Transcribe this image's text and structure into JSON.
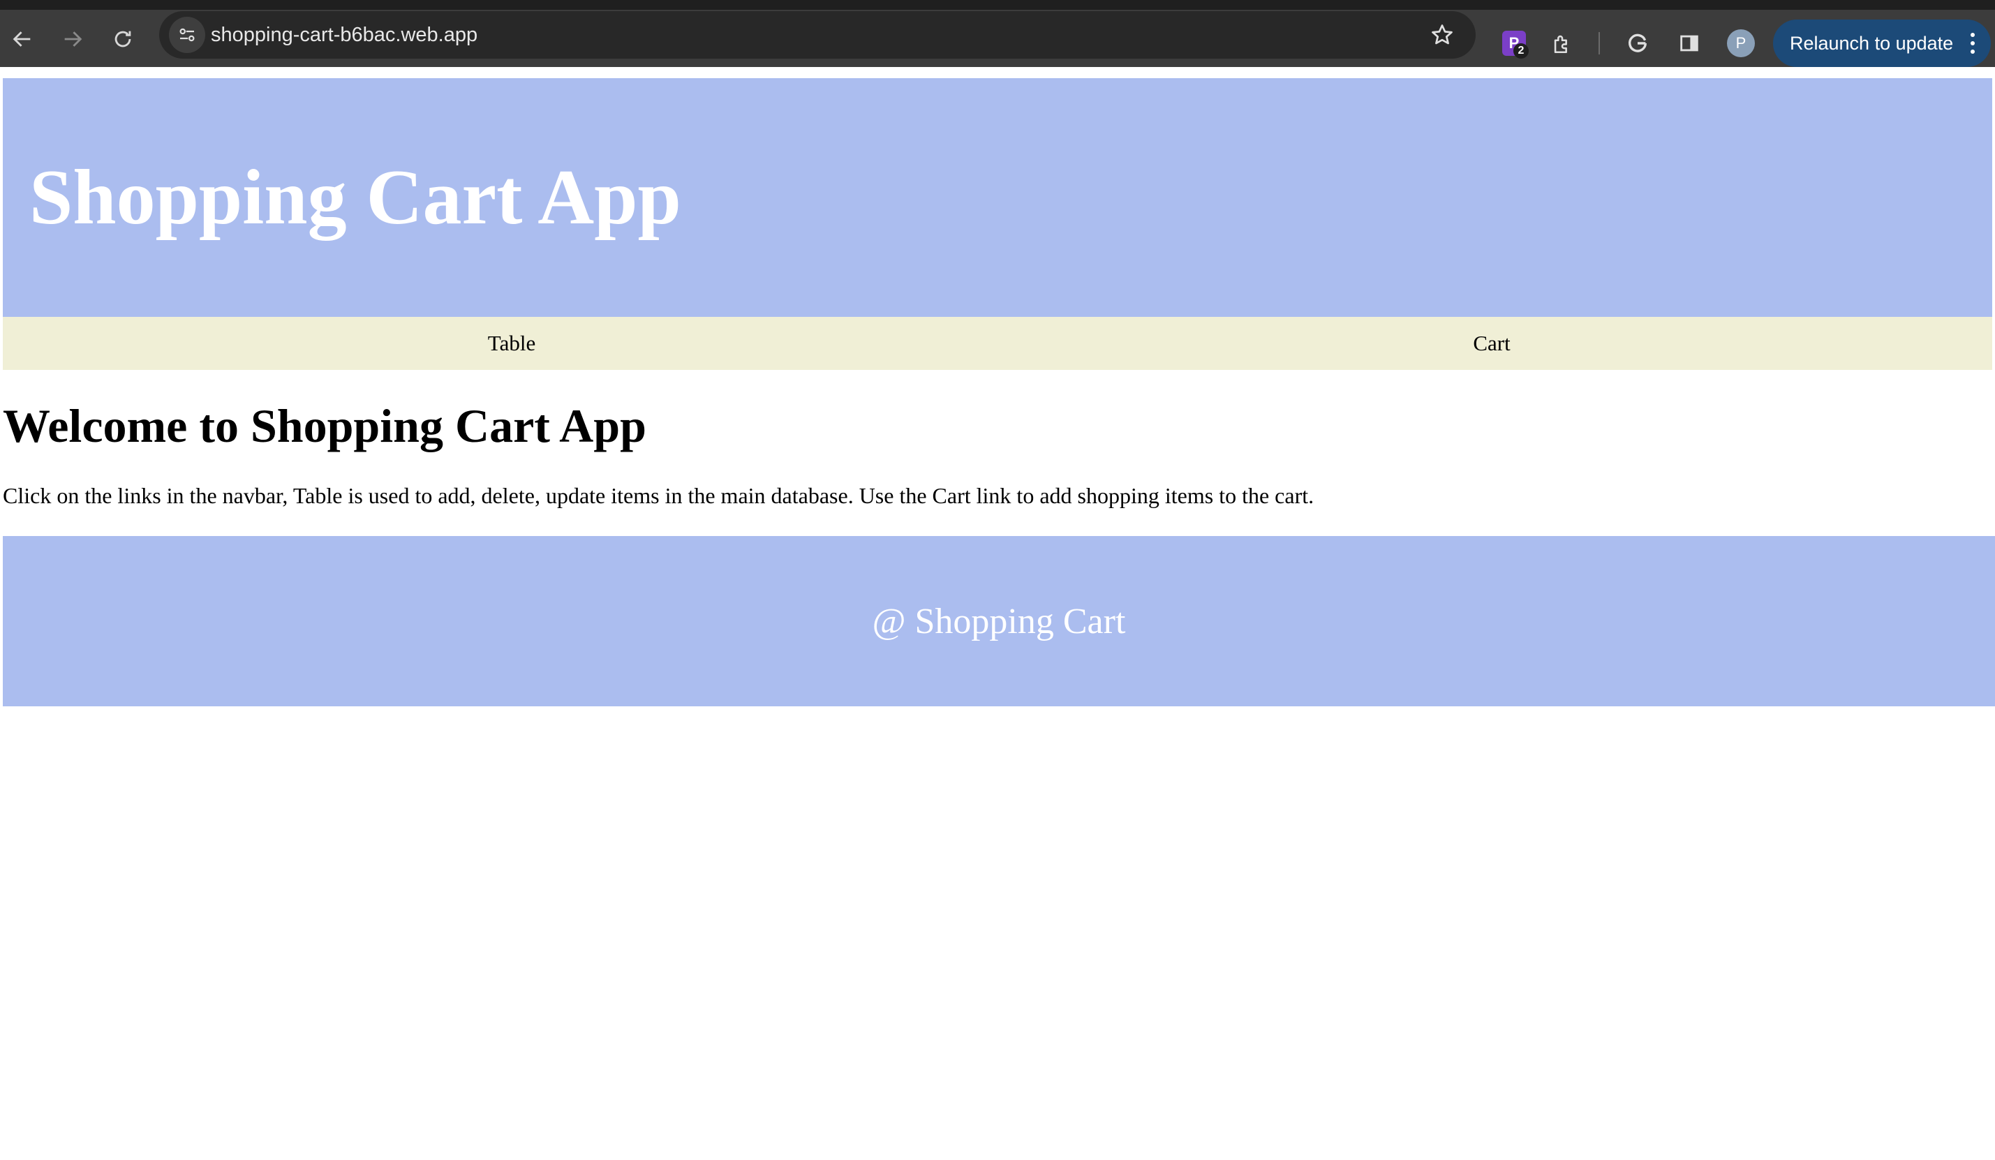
{
  "browser": {
    "url": "shopping-cart-b6bac.web.app",
    "extension_letter": "P",
    "extension_badge": "2",
    "profile_initial": "P",
    "relaunch_label": "Relaunch to update",
    "icons": [
      "back-arrow-icon",
      "forward-arrow-icon",
      "reload-icon",
      "site-settings-icon",
      "star-icon",
      "extension-puzzle-icon",
      "google-icon",
      "side-panel-icon",
      "more-vert-icon"
    ]
  },
  "page": {
    "header_title": "Shopping Cart App",
    "nav": [
      {
        "label": "Table"
      },
      {
        "label": "Cart"
      }
    ],
    "welcome_heading": "Welcome to Shopping Cart App",
    "intro_text": "Click on the links in the navbar, Table is used to add, delete, update items in the main database. Use the Cart link to add shopping items to the cart.",
    "footer_text": "@ Shopping Cart"
  },
  "colors": {
    "header_bg": "#abbdef",
    "navbar_bg": "#f0efd6",
    "footer_bg": "#abbdef",
    "chrome_bg": "#3c3c3c",
    "relaunch_bg": "#1c4a78"
  }
}
